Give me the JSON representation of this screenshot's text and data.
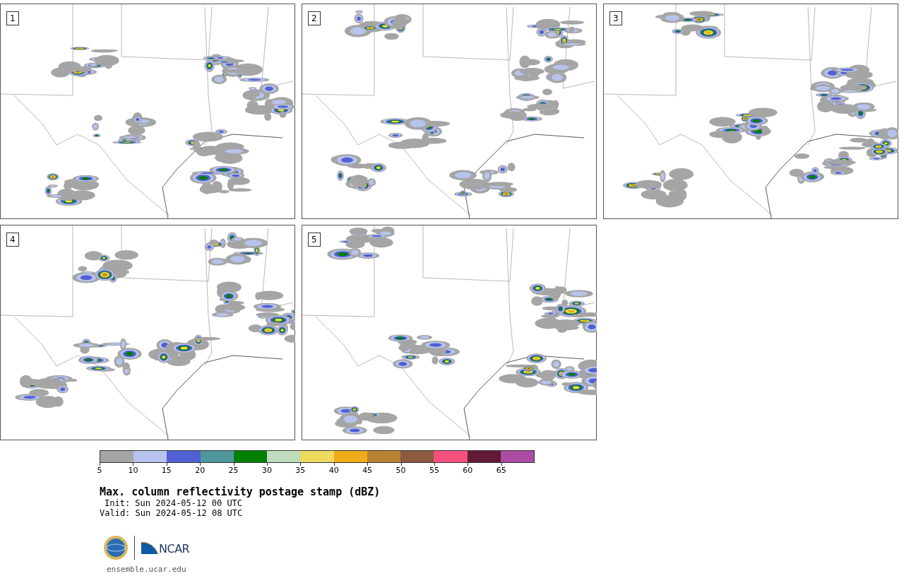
{
  "panels": [
    {
      "label": "1"
    },
    {
      "label": "2"
    },
    {
      "label": "3"
    },
    {
      "label": "4"
    },
    {
      "label": "5"
    }
  ],
  "colorbar": {
    "segments": [
      {
        "label": "5",
        "color": "#a5a5a5"
      },
      {
        "label": "10",
        "color": "#b6c3ed"
      },
      {
        "label": "15",
        "color": "#5260d6"
      },
      {
        "label": "20",
        "color": "#50979c"
      },
      {
        "label": "25",
        "color": "#008000"
      },
      {
        "label": "30",
        "color": "#bfdcbf"
      },
      {
        "label": "35",
        "color": "#eeda5e"
      },
      {
        "label": "40",
        "color": "#f0ab18"
      },
      {
        "label": "45",
        "color": "#b98232"
      },
      {
        "label": "50",
        "color": "#8b5a3f"
      },
      {
        "label": "55",
        "color": "#f4517e"
      },
      {
        "label": "60",
        "color": "#621a37"
      },
      {
        "label": "65",
        "color": "#ab4ba4"
      }
    ]
  },
  "title": "Max. column reflectivity postage stamp (dBZ)",
  "init": "Init: Sun 2024-05-12 00 UTC",
  "valid": "Valid: Sun 2024-05-12 08 UTC",
  "logo": {
    "text": "NCAR"
  },
  "url": "ensemble.ucar.edu"
}
